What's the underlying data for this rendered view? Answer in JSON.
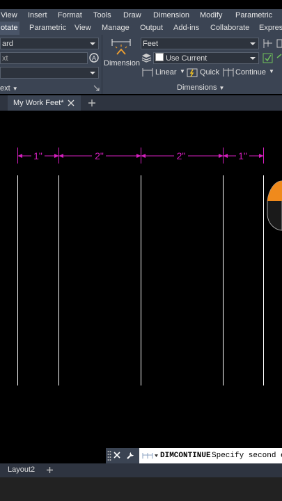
{
  "menu": [
    "View",
    "Insert",
    "Format",
    "Tools",
    "Draw",
    "Dimension",
    "Modify",
    "Parametric"
  ],
  "ribbon_tabs": [
    "otate",
    "Parametric",
    "View",
    "Manage",
    "Output",
    "Add-ins",
    "Collaborate",
    "Express"
  ],
  "left_panel": {
    "style_value": "ard",
    "text_value": "xt",
    "label": "ext"
  },
  "dimension_panel": {
    "button_label": "Dimension",
    "style_value": "Feet",
    "layer_value": "Use Current",
    "linear_label": "Linear",
    "quick_label": "Quick",
    "continue_label": "Continue",
    "panel_label": "Dimensions"
  },
  "document_tab": "My Work Feet*",
  "dimensions": [
    "1\"",
    "2\"",
    "2\"",
    "1\""
  ],
  "layout_tab": "Layout2",
  "command": {
    "name": "DIMCONTINUE",
    "prompt": "Specify second e"
  },
  "colors": {
    "dimension": "#d61fbf",
    "ribbon": "#3b4453",
    "geometry": "#ffffff"
  }
}
